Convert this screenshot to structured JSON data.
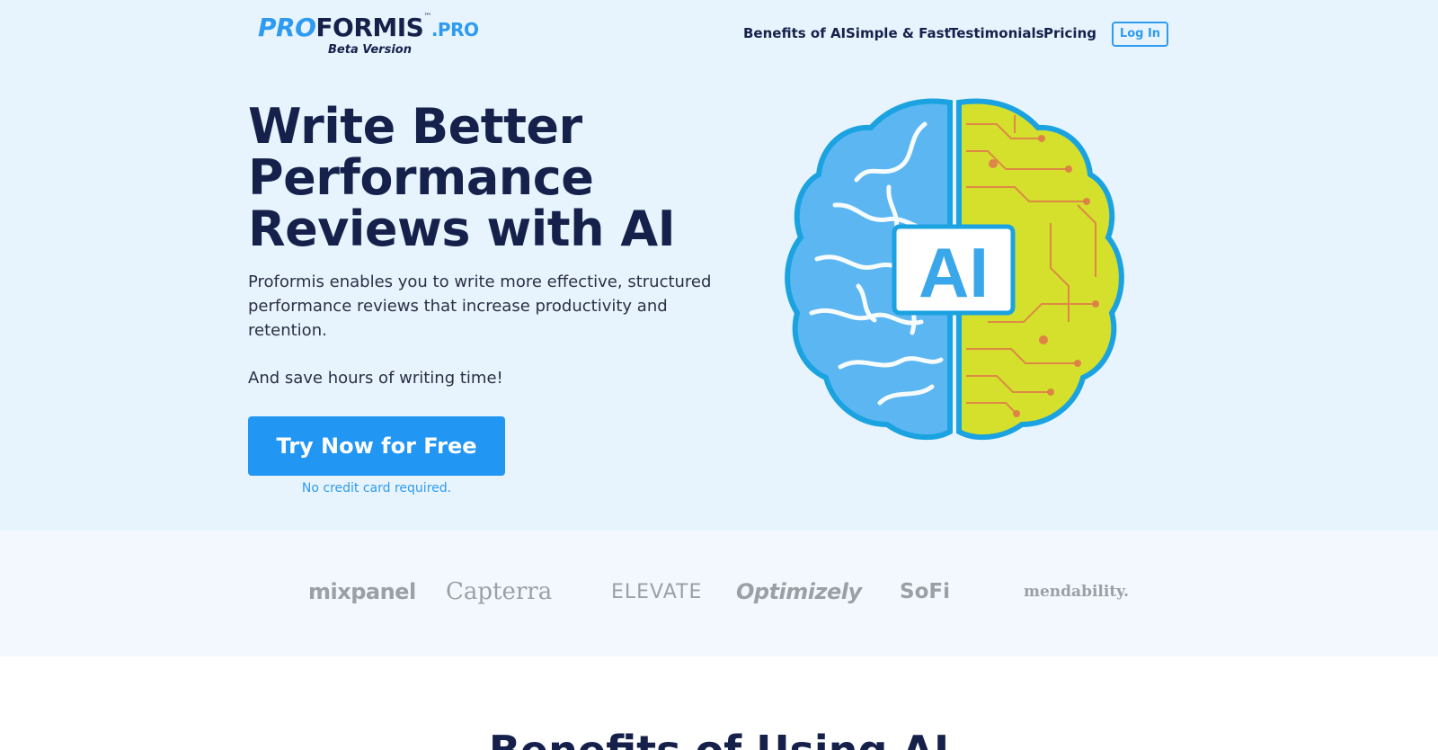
{
  "header": {
    "logo": {
      "part1": "PRO",
      "part2": "FORMIS",
      "tm": "™",
      "suffix": ".PRO",
      "tagline": "Beta Version"
    },
    "nav": [
      {
        "label": "Benefits of AI"
      },
      {
        "label": "Simple & Fast"
      },
      {
        "label": "Testimonials"
      },
      {
        "label": "Pricing"
      }
    ],
    "login_label": "Log In"
  },
  "hero": {
    "headline": [
      "Write Better",
      "Performance",
      "Reviews with AI"
    ],
    "subtext": "Proformis enables you to write more effective, structured performance reviews that increase productivity and retention.",
    "subtext2": "And save hours of writing time!",
    "cta_label": "Try Now for Free",
    "cta_note": "No credit card required.",
    "illustration_badge": "AI"
  },
  "brands": {
    "mixpanel": "mixpanel",
    "capterra": "Capterra",
    "elevate": "ELEVATE",
    "optimizely": "Optimizely",
    "sofi": "SoFi",
    "mendability": "mendability."
  },
  "section": {
    "title": "Benefits of Using AI"
  },
  "colors": {
    "hero_bg": "#e8f4fd",
    "navy": "#15214a",
    "accent": "#2196f3",
    "brain_left": "#5bb6f2",
    "brain_right": "#d4e02c",
    "brand_gray": "#9aa0a6"
  }
}
